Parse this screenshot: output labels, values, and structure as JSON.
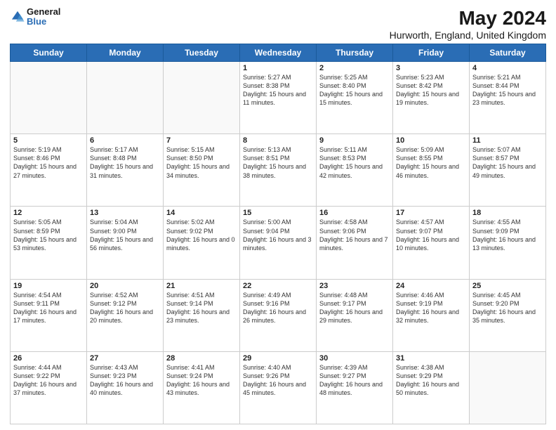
{
  "header": {
    "logo_line1": "General",
    "logo_line2": "Blue",
    "title": "May 2024",
    "subtitle": "Hurworth, England, United Kingdom"
  },
  "days_of_week": [
    "Sunday",
    "Monday",
    "Tuesday",
    "Wednesday",
    "Thursday",
    "Friday",
    "Saturday"
  ],
  "weeks": [
    [
      {
        "day": "",
        "info": ""
      },
      {
        "day": "",
        "info": ""
      },
      {
        "day": "",
        "info": ""
      },
      {
        "day": "1",
        "info": "Sunrise: 5:27 AM\nSunset: 8:38 PM\nDaylight: 15 hours\nand 11 minutes."
      },
      {
        "day": "2",
        "info": "Sunrise: 5:25 AM\nSunset: 8:40 PM\nDaylight: 15 hours\nand 15 minutes."
      },
      {
        "day": "3",
        "info": "Sunrise: 5:23 AM\nSunset: 8:42 PM\nDaylight: 15 hours\nand 19 minutes."
      },
      {
        "day": "4",
        "info": "Sunrise: 5:21 AM\nSunset: 8:44 PM\nDaylight: 15 hours\nand 23 minutes."
      }
    ],
    [
      {
        "day": "5",
        "info": "Sunrise: 5:19 AM\nSunset: 8:46 PM\nDaylight: 15 hours\nand 27 minutes."
      },
      {
        "day": "6",
        "info": "Sunrise: 5:17 AM\nSunset: 8:48 PM\nDaylight: 15 hours\nand 31 minutes."
      },
      {
        "day": "7",
        "info": "Sunrise: 5:15 AM\nSunset: 8:50 PM\nDaylight: 15 hours\nand 34 minutes."
      },
      {
        "day": "8",
        "info": "Sunrise: 5:13 AM\nSunset: 8:51 PM\nDaylight: 15 hours\nand 38 minutes."
      },
      {
        "day": "9",
        "info": "Sunrise: 5:11 AM\nSunset: 8:53 PM\nDaylight: 15 hours\nand 42 minutes."
      },
      {
        "day": "10",
        "info": "Sunrise: 5:09 AM\nSunset: 8:55 PM\nDaylight: 15 hours\nand 46 minutes."
      },
      {
        "day": "11",
        "info": "Sunrise: 5:07 AM\nSunset: 8:57 PM\nDaylight: 15 hours\nand 49 minutes."
      }
    ],
    [
      {
        "day": "12",
        "info": "Sunrise: 5:05 AM\nSunset: 8:59 PM\nDaylight: 15 hours\nand 53 minutes."
      },
      {
        "day": "13",
        "info": "Sunrise: 5:04 AM\nSunset: 9:00 PM\nDaylight: 15 hours\nand 56 minutes."
      },
      {
        "day": "14",
        "info": "Sunrise: 5:02 AM\nSunset: 9:02 PM\nDaylight: 16 hours\nand 0 minutes."
      },
      {
        "day": "15",
        "info": "Sunrise: 5:00 AM\nSunset: 9:04 PM\nDaylight: 16 hours\nand 3 minutes."
      },
      {
        "day": "16",
        "info": "Sunrise: 4:58 AM\nSunset: 9:06 PM\nDaylight: 16 hours\nand 7 minutes."
      },
      {
        "day": "17",
        "info": "Sunrise: 4:57 AM\nSunset: 9:07 PM\nDaylight: 16 hours\nand 10 minutes."
      },
      {
        "day": "18",
        "info": "Sunrise: 4:55 AM\nSunset: 9:09 PM\nDaylight: 16 hours\nand 13 minutes."
      }
    ],
    [
      {
        "day": "19",
        "info": "Sunrise: 4:54 AM\nSunset: 9:11 PM\nDaylight: 16 hours\nand 17 minutes."
      },
      {
        "day": "20",
        "info": "Sunrise: 4:52 AM\nSunset: 9:12 PM\nDaylight: 16 hours\nand 20 minutes."
      },
      {
        "day": "21",
        "info": "Sunrise: 4:51 AM\nSunset: 9:14 PM\nDaylight: 16 hours\nand 23 minutes."
      },
      {
        "day": "22",
        "info": "Sunrise: 4:49 AM\nSunset: 9:16 PM\nDaylight: 16 hours\nand 26 minutes."
      },
      {
        "day": "23",
        "info": "Sunrise: 4:48 AM\nSunset: 9:17 PM\nDaylight: 16 hours\nand 29 minutes."
      },
      {
        "day": "24",
        "info": "Sunrise: 4:46 AM\nSunset: 9:19 PM\nDaylight: 16 hours\nand 32 minutes."
      },
      {
        "day": "25",
        "info": "Sunrise: 4:45 AM\nSunset: 9:20 PM\nDaylight: 16 hours\nand 35 minutes."
      }
    ],
    [
      {
        "day": "26",
        "info": "Sunrise: 4:44 AM\nSunset: 9:22 PM\nDaylight: 16 hours\nand 37 minutes."
      },
      {
        "day": "27",
        "info": "Sunrise: 4:43 AM\nSunset: 9:23 PM\nDaylight: 16 hours\nand 40 minutes."
      },
      {
        "day": "28",
        "info": "Sunrise: 4:41 AM\nSunset: 9:24 PM\nDaylight: 16 hours\nand 43 minutes."
      },
      {
        "day": "29",
        "info": "Sunrise: 4:40 AM\nSunset: 9:26 PM\nDaylight: 16 hours\nand 45 minutes."
      },
      {
        "day": "30",
        "info": "Sunrise: 4:39 AM\nSunset: 9:27 PM\nDaylight: 16 hours\nand 48 minutes."
      },
      {
        "day": "31",
        "info": "Sunrise: 4:38 AM\nSunset: 9:29 PM\nDaylight: 16 hours\nand 50 minutes."
      },
      {
        "day": "",
        "info": ""
      }
    ]
  ]
}
